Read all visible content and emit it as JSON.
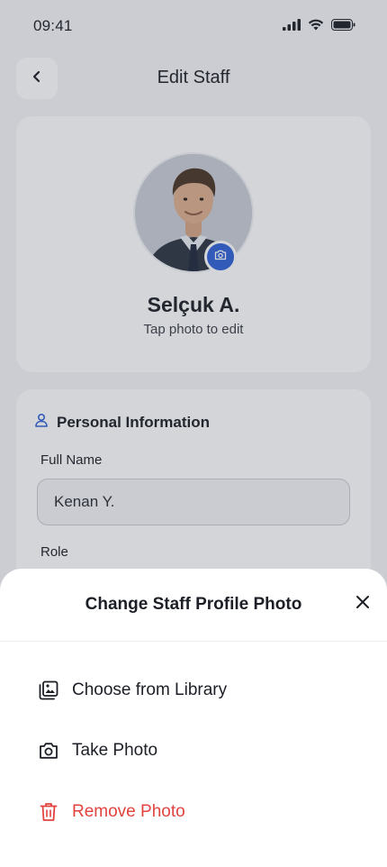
{
  "status_bar": {
    "time": "09:41",
    "icons": [
      "cellular-signal-icon",
      "wifi-icon",
      "battery-icon"
    ]
  },
  "header": {
    "title": "Edit Staff",
    "back_icon": "chevron-left-icon"
  },
  "profile": {
    "name": "Selçuk A.",
    "hint": "Tap photo to edit",
    "camera_icon": "camera-icon"
  },
  "personal_info": {
    "section_icon": "user-icon",
    "title": "Personal Information",
    "full_name_label": "Full Name",
    "full_name_value": "Kenan Y.",
    "role_label": "Role"
  },
  "sheet": {
    "title": "Change Staff Profile Photo",
    "close_icon": "close-icon",
    "options": [
      {
        "icon": "photo-library-icon",
        "label": "Choose from Library"
      },
      {
        "icon": "camera-icon",
        "label": "Take Photo"
      },
      {
        "icon": "trash-icon",
        "label": "Remove Photo"
      }
    ]
  },
  "colors": {
    "accent": "#2f62d8",
    "danger": "#e2433f",
    "text": "#1c1f26",
    "background": "#f4f5f8"
  }
}
